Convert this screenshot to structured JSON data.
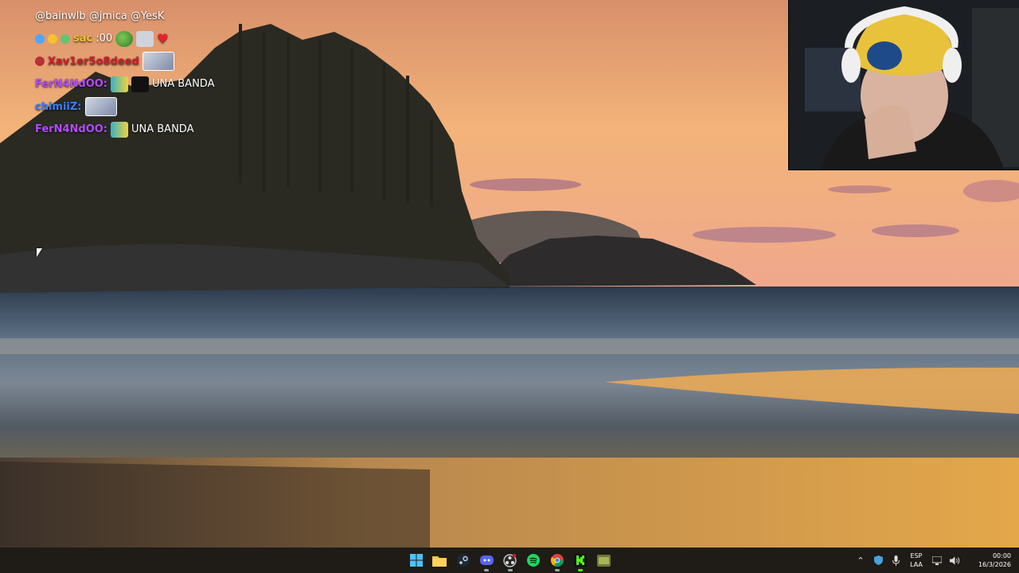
{
  "chat": {
    "messages": [
      {
        "user": "",
        "text": "@bainwlb @jmica @YesK"
      },
      {
        "user": "sac",
        "text": ":00"
      },
      {
        "user": "Xav1er5o8deed",
        "text": ""
      },
      {
        "user": "FerN4NdOO:",
        "text": "UNA BANDA"
      },
      {
        "user": "chimiiZ:",
        "text": ""
      },
      {
        "user": "FerN4NdOO:",
        "text": "UNA BANDA"
      }
    ],
    "colors": {
      "fern": "#b34cff",
      "chimi": "#3a7dff",
      "xav": "#d41c2a",
      "sac": "#f1c232"
    }
  },
  "webcam": {
    "label": "webcam"
  },
  "taskbar": {
    "apps": [
      {
        "name": "windows-start-icon"
      },
      {
        "name": "file-explorer-icon"
      },
      {
        "name": "steam-icon"
      },
      {
        "name": "discord-icon"
      },
      {
        "name": "obs-icon"
      },
      {
        "name": "spotify-icon"
      },
      {
        "name": "chrome-icon"
      },
      {
        "name": "kick-icon"
      },
      {
        "name": "game-icon"
      }
    ],
    "tray": {
      "lang_top": "ESP",
      "lang_bottom": "LAA",
      "time": "00:00",
      "date": "16/3/2026"
    }
  }
}
